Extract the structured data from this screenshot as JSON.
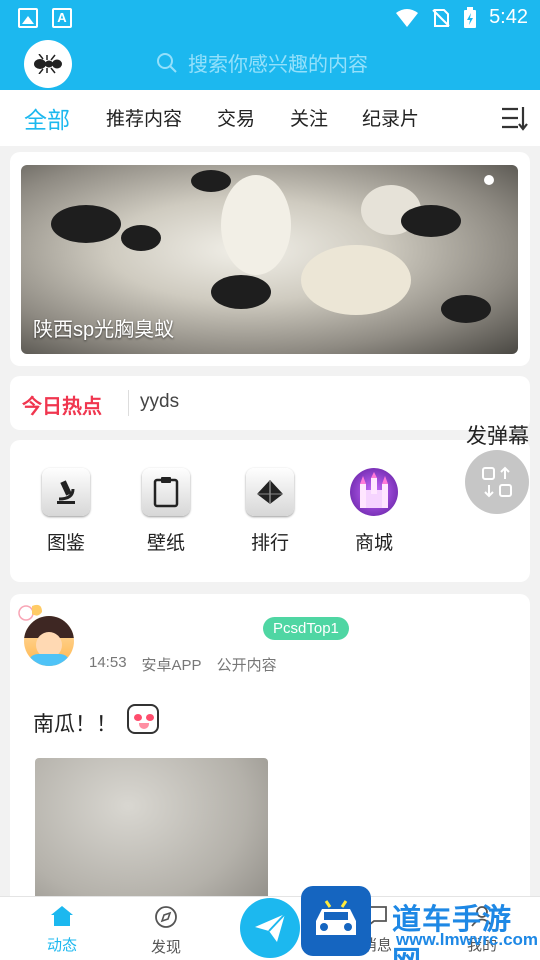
{
  "status_bar": {
    "time": "5:42"
  },
  "header": {
    "search_placeholder": "搜索你感兴趣的内容"
  },
  "tabs": [
    {
      "label": "全部",
      "active": true
    },
    {
      "label": "推荐内容"
    },
    {
      "label": "交易"
    },
    {
      "label": "关注"
    },
    {
      "label": "纪录片"
    }
  ],
  "banner": {
    "caption": "陕西sp光胸臭蚁"
  },
  "hot": {
    "title": "今日热点",
    "item": "yyds"
  },
  "quick_menu": [
    {
      "label": "图鉴",
      "icon": "microscope-icon"
    },
    {
      "label": "壁纸",
      "icon": "clipboard-icon"
    },
    {
      "label": "排行",
      "icon": "pyramid-icon"
    },
    {
      "label": "商城",
      "icon": "castle-icon"
    }
  ],
  "danmaku": {
    "label": "发弹幕"
  },
  "post": {
    "tag": "PcsdTop1",
    "time": "14:53",
    "source": "安卓APP",
    "visibility": "公开内容",
    "text": "南瓜！！"
  },
  "bottom_nav": [
    {
      "label": "动态",
      "icon": "home-icon",
      "active": true
    },
    {
      "label": "发现",
      "icon": "compass-icon"
    },
    {
      "label": "消息",
      "icon": "message-icon"
    },
    {
      "label": "我的",
      "icon": "user-icon"
    }
  ],
  "watermark": {
    "title": "道车手游网",
    "url": "www.lmwvrc.com"
  },
  "colors": {
    "accent": "#1cb8ef",
    "hot_red": "#f0364f",
    "tag_green": "#4fd6a3"
  }
}
